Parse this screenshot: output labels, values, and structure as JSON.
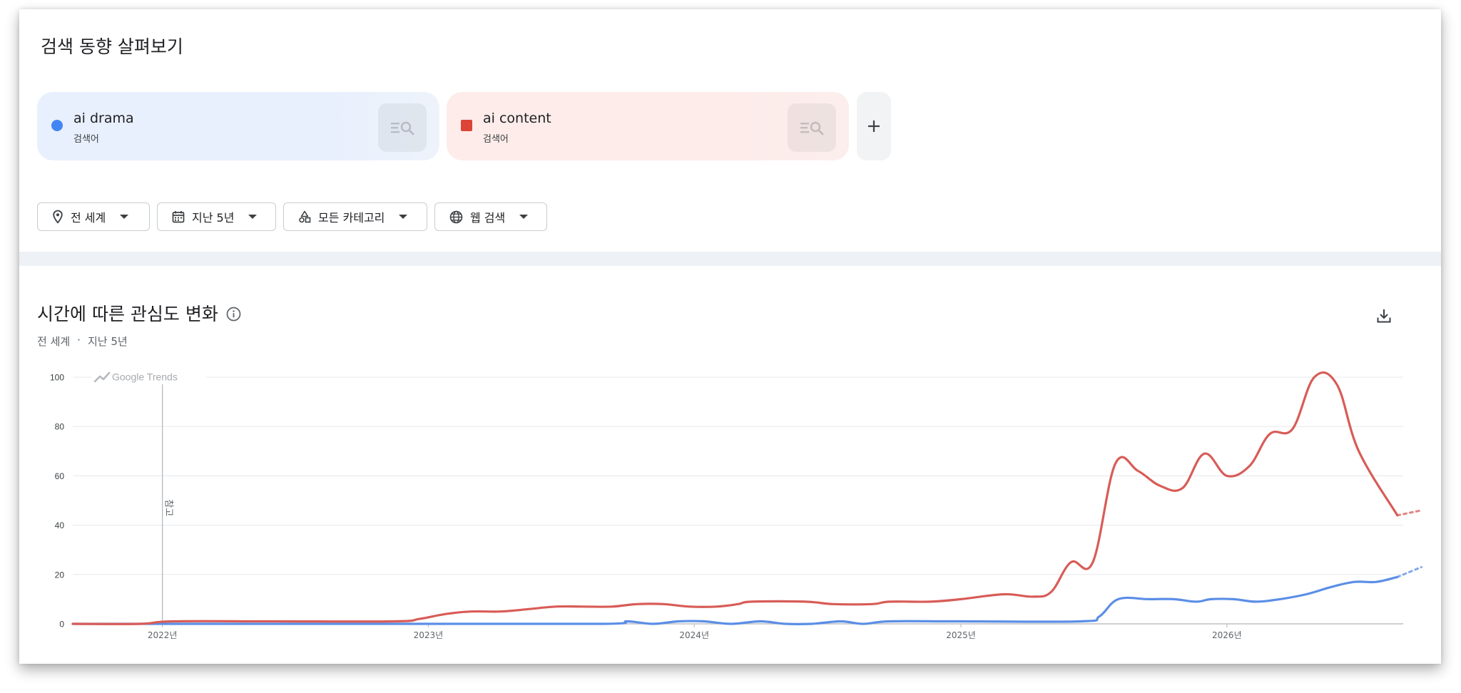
{
  "header": {
    "title": "검색 동향 살펴보기"
  },
  "terms": [
    {
      "name": "ai drama",
      "type": "검색어",
      "color": "#4285f4",
      "marker": "circle"
    },
    {
      "name": "ai content",
      "type": "검색어",
      "color": "#db4437",
      "marker": "square"
    }
  ],
  "filters": [
    {
      "label": "전 세계",
      "icon": "location-pin-icon"
    },
    {
      "label": "지난 5년",
      "icon": "calendar-icon"
    },
    {
      "label": "모든 카테고리",
      "icon": "category-shapes-icon"
    },
    {
      "label": "웹 검색",
      "icon": "globe-icon"
    }
  ],
  "chart_section": {
    "title": "시간에 따른 관심도 변화",
    "subtitle_region": "전 세계",
    "subtitle_sep": "·",
    "subtitle_period": "지난 5년",
    "watermark": "Google Trends",
    "note_label": "참고"
  },
  "chart_data": {
    "type": "line",
    "ylim": [
      0,
      100
    ],
    "yticks": [
      0,
      20,
      40,
      60,
      80,
      100
    ],
    "xlim": [
      "2021-08-31",
      "2026-08-31"
    ],
    "xticks": [
      {
        "date": "2022-01-01",
        "label": "2022년"
      },
      {
        "date": "2023-01-01",
        "label": "2023년"
      },
      {
        "date": "2024-01-01",
        "label": "2024년"
      },
      {
        "date": "2025-01-01",
        "label": "2025년"
      },
      {
        "date": "2026-01-01",
        "label": "2026년"
      }
    ],
    "note_date": "2022-01-01",
    "grid": true,
    "series": [
      {
        "name": "ai drama",
        "color": "#5b8ee6",
        "points": [
          [
            "2021-08-31",
            0
          ],
          [
            "2022-01-01",
            0
          ],
          [
            "2023-01-01",
            0
          ],
          [
            "2023-08-31",
            0
          ],
          [
            "2023-10-01",
            1
          ],
          [
            "2023-11-05",
            0
          ],
          [
            "2023-12-10",
            1
          ],
          [
            "2024-01-15",
            1
          ],
          [
            "2024-02-20",
            0
          ],
          [
            "2024-04-01",
            1
          ],
          [
            "2024-05-05",
            0
          ],
          [
            "2024-06-10",
            0
          ],
          [
            "2024-07-20",
            1
          ],
          [
            "2024-08-20",
            0
          ],
          [
            "2024-09-25",
            1
          ],
          [
            "2025-01-01",
            1
          ],
          [
            "2025-06-15",
            1
          ],
          [
            "2025-07-10",
            3
          ],
          [
            "2025-08-05",
            10
          ],
          [
            "2025-09-15",
            10
          ],
          [
            "2025-10-20",
            10
          ],
          [
            "2025-11-20",
            9
          ],
          [
            "2025-12-10",
            10
          ],
          [
            "2026-01-10",
            10
          ],
          [
            "2026-02-10",
            9
          ],
          [
            "2026-03-15",
            10
          ],
          [
            "2026-04-20",
            12
          ],
          [
            "2026-05-25",
            15
          ],
          [
            "2026-06-25",
            17
          ],
          [
            "2026-07-25",
            17
          ],
          [
            "2026-08-23",
            19
          ]
        ],
        "forecast": [
          [
            "2026-08-23",
            19
          ],
          [
            "2026-09-25",
            23
          ]
        ]
      },
      {
        "name": "ai content",
        "color": "#d85c57",
        "points": [
          [
            "2021-08-31",
            0
          ],
          [
            "2021-12-01",
            0
          ],
          [
            "2022-01-15",
            1
          ],
          [
            "2022-06-01",
            1
          ],
          [
            "2022-11-15",
            1
          ],
          [
            "2022-12-20",
            2
          ],
          [
            "2023-01-25",
            4
          ],
          [
            "2023-03-01",
            5
          ],
          [
            "2023-04-10",
            5
          ],
          [
            "2023-05-20",
            6
          ],
          [
            "2023-06-25",
            7
          ],
          [
            "2023-08-01",
            7
          ],
          [
            "2023-09-10",
            7
          ],
          [
            "2023-10-15",
            8
          ],
          [
            "2023-11-20",
            8
          ],
          [
            "2023-12-25",
            7
          ],
          [
            "2024-02-01",
            7
          ],
          [
            "2024-03-01",
            8
          ],
          [
            "2024-03-20",
            9
          ],
          [
            "2024-06-01",
            9
          ],
          [
            "2024-07-10",
            8
          ],
          [
            "2024-09-01",
            8
          ],
          [
            "2024-09-25",
            9
          ],
          [
            "2024-11-20",
            9
          ],
          [
            "2025-01-01",
            10
          ],
          [
            "2025-03-01",
            12
          ],
          [
            "2025-04-10",
            11
          ],
          [
            "2025-05-05",
            13
          ],
          [
            "2025-06-01",
            25
          ],
          [
            "2025-07-01",
            25
          ],
          [
            "2025-08-01",
            65
          ],
          [
            "2025-09-01",
            62
          ],
          [
            "2025-10-01",
            56
          ],
          [
            "2025-11-01",
            55
          ],
          [
            "2025-12-01",
            69
          ],
          [
            "2026-01-01",
            60
          ],
          [
            "2026-02-01",
            64
          ],
          [
            "2026-03-01",
            77
          ],
          [
            "2026-04-01",
            79
          ],
          [
            "2026-05-01",
            100
          ],
          [
            "2026-06-01",
            97
          ],
          [
            "2026-07-01",
            70
          ],
          [
            "2026-08-23",
            44
          ]
        ],
        "forecast": [
          [
            "2026-08-23",
            44
          ],
          [
            "2026-09-25",
            46
          ]
        ]
      }
    ]
  }
}
